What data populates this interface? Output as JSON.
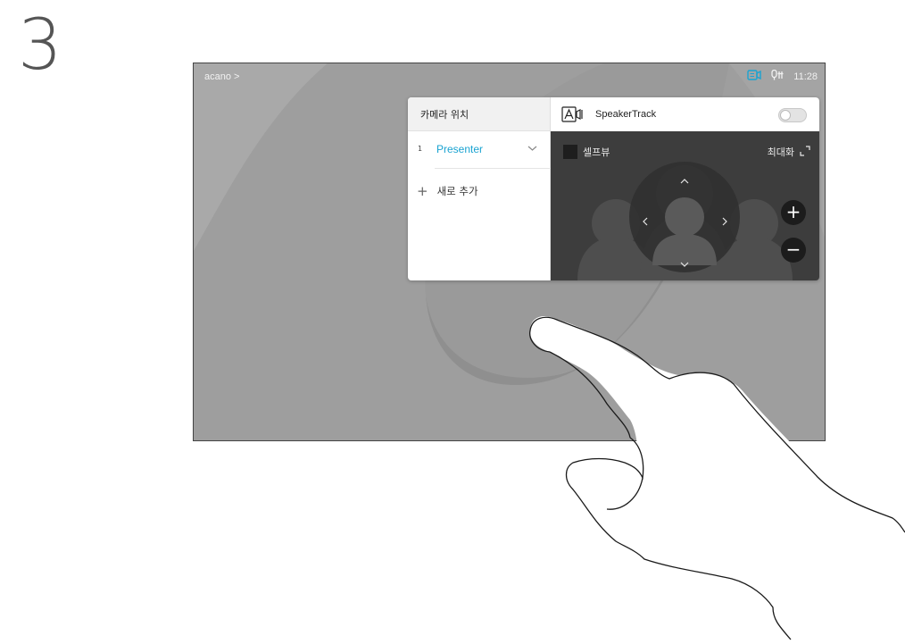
{
  "step_number": "3",
  "titlebar": {
    "left_label": "acano >",
    "time": "11:28"
  },
  "panel": {
    "left_header": "카메라 위치",
    "presets": [
      {
        "number": "1",
        "name": "Presenter"
      }
    ],
    "add_label": "새로 추가",
    "speakertrack_label": "SpeakerTrack",
    "speakertrack_on": false,
    "selfview_label": "셀프뷰",
    "maximize_label": "최대화"
  },
  "colors": {
    "accent": "#1aa3d1",
    "camera_icon": "#1aa3d1",
    "panel_dark": "#3d3d3d",
    "screen_bg": "#9b9b9b"
  },
  "icons": {
    "camera_status": "camera-icon",
    "mic_status": "microphone-icon",
    "speakertrack": "speakertrack-icon",
    "maximize": "maximize-icon",
    "preset_expand": "chevron-down-icon",
    "add": "plus-icon",
    "zoom_in": "plus-icon",
    "zoom_out": "minus-icon",
    "pan_up": "chevron-up-icon",
    "pan_down": "chevron-down-icon",
    "pan_left": "chevron-left-icon",
    "pan_right": "chevron-right-icon"
  }
}
